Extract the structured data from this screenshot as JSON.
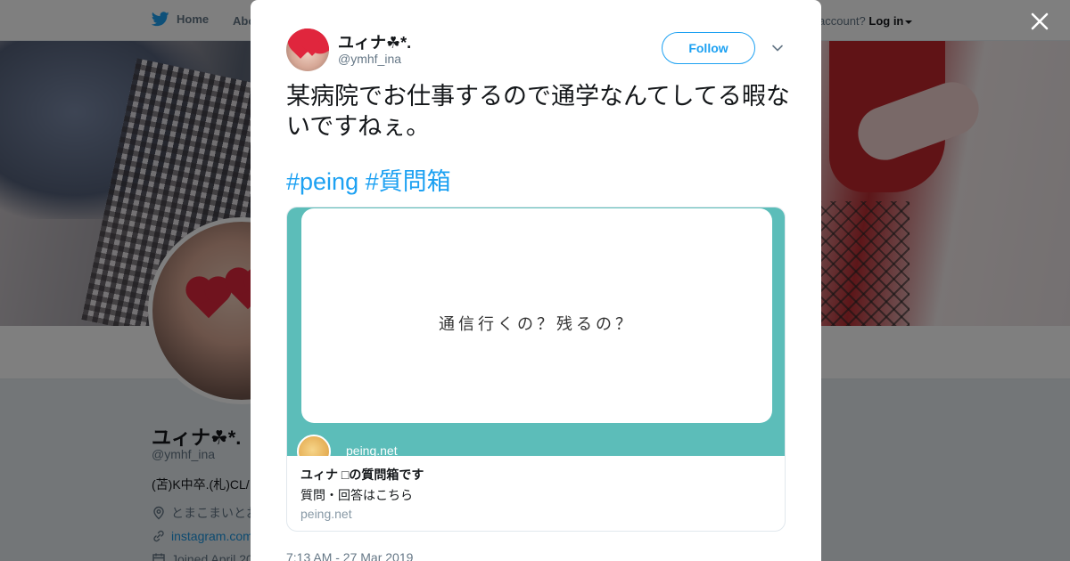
{
  "topbar": {
    "home_label": "Home",
    "about_label": "Abo",
    "account_prompt": "account?",
    "login_label": "Log in"
  },
  "profile": {
    "name": "ユィナ☘*.",
    "handle": "@ymhf_ina",
    "bio": "(苫)K中卒.(札)CL/",
    "location": "とまこまいとお",
    "website": "instagram.com",
    "joined": "Joined April 20"
  },
  "tweet": {
    "author_name": "ユィナ☘*.",
    "author_handle": "@ymhf_ina",
    "follow_label": "Follow",
    "text": "某病院でお仕事するので通学なんてしてる暇ないですねぇ。",
    "hashtags": [
      "#peing",
      "#質問箱"
    ],
    "timestamp": "7:13 AM - 27 Mar 2019"
  },
  "card": {
    "question": "通信行くの？残るの？",
    "site_label": "peing.net",
    "title": "ユィナ □の質問箱です",
    "description": "質問・回答はこちら",
    "domain": "peing.net"
  },
  "colors": {
    "accent": "#1da1f2",
    "card_teal": "#5cbdb9",
    "scrim": "rgba(0,0,0,0.5)"
  },
  "icons": {
    "home": "twitter-bird-icon",
    "close": "close-icon",
    "more": "chevron-down-icon",
    "location": "location-pin-icon",
    "link": "link-icon",
    "calendar": "calendar-icon"
  }
}
